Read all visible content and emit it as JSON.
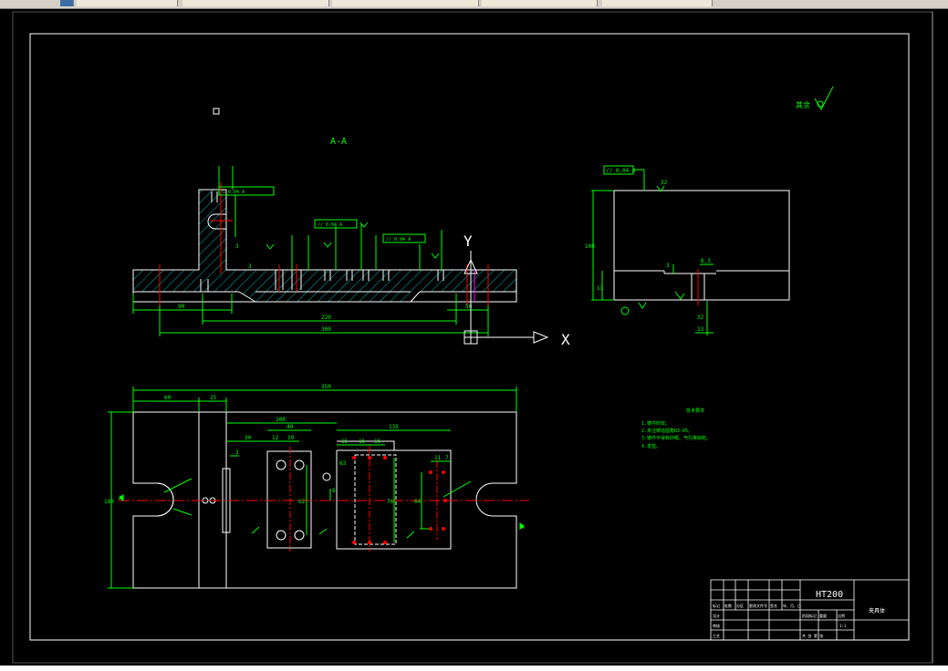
{
  "drawing": {
    "section_label": "A-A",
    "material": "HT200",
    "roughness_note": "其余",
    "tech_req_title": "技术要求",
    "tech_requirements": [
      "1.铸件时效。",
      "2.未注铸造圆角R3-R5。",
      "3.铸件不得有砂眼、气孔等缺陷。",
      "4.发蓝。"
    ],
    "part_name": "夹具体",
    "dimensions": {
      "d90": "90",
      "d220": "220",
      "d300": "300",
      "d50": "50",
      "d350": "350",
      "d60": "60",
      "d25": "25",
      "d100": "100",
      "d40": "40",
      "d30": "30",
      "d12": "12",
      "d19": "19",
      "d135": "135",
      "d15a": "15",
      "d15b": "15",
      "d140": "140",
      "d15c": "15",
      "d7": "7",
      "d11": "11",
      "d3": "3",
      "d8": "8",
      "d62": "62",
      "d76": "76",
      "d64": "64",
      "d63": "63",
      "d13": "13",
      "d32": "32",
      "d6_3": "6.3",
      "d150": "150",
      "d180": "180"
    },
    "tolerances": {
      "perp": "⊥ 0.04 A",
      "par1": "// 0.04 A",
      "par2": "// 0.04 A",
      "par3": "// 0.04 A"
    },
    "datum_letters": {
      "a": "A",
      "b": "A"
    },
    "axis": {
      "x": "X",
      "y": "Y"
    },
    "title_block": {
      "row_labels": [
        "标记",
        "设计",
        "审核",
        "工艺"
      ],
      "col_labels": [
        "处数",
        "分区",
        "更改文件号",
        "签名",
        "年、月、日"
      ],
      "stage": "阶段标记",
      "weight": "重量",
      "scale": "比例",
      "ratio": "1:1",
      "sheets": "共 张 第 张"
    }
  },
  "colors": {
    "bg": "#000000",
    "line": "#ffffff",
    "dim": "#00ff00",
    "center": "#ff0000",
    "hatch": "#00ffff",
    "hidden": "#ffff00"
  }
}
